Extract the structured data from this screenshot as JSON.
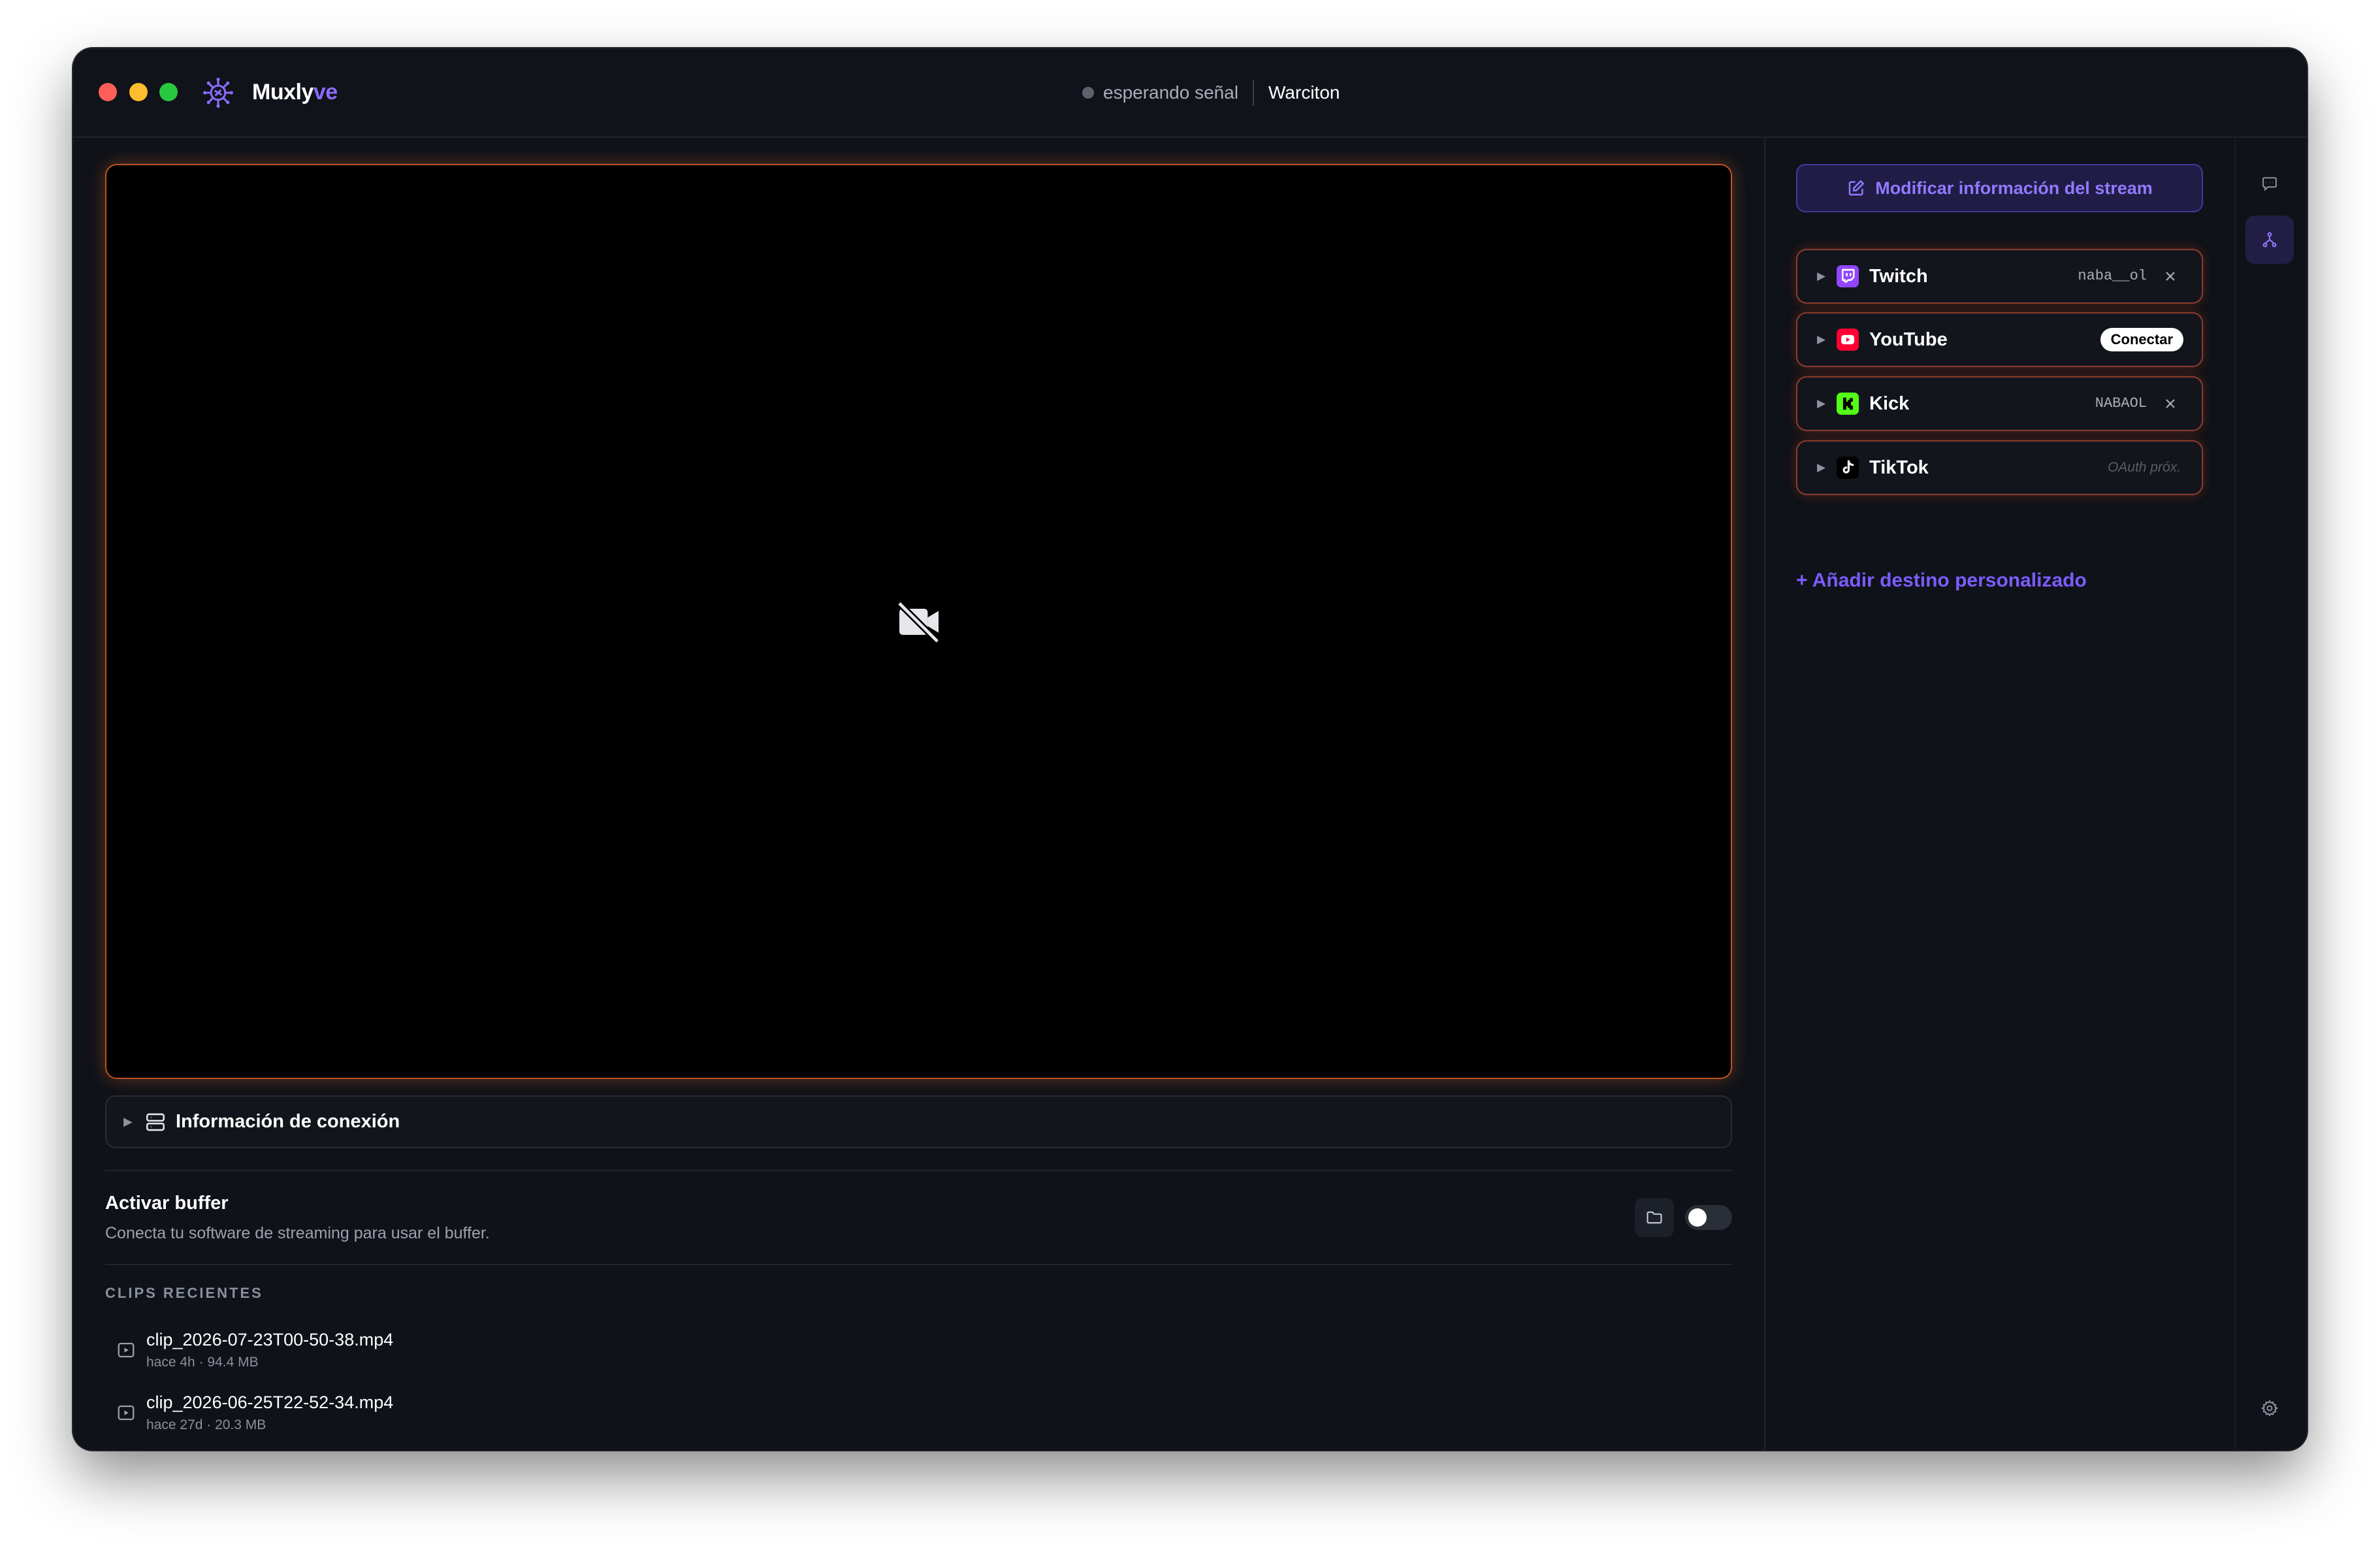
{
  "app": {
    "name_main": "Muxly",
    "name_accent": "ve",
    "logo_icon": "virus-logo-icon"
  },
  "status": {
    "text": "esperando señal",
    "channel": "Warciton",
    "state_color": "#5d626c"
  },
  "video": {
    "placeholder_icon": "camera-off-icon"
  },
  "connection": {
    "label": "Información de conexión",
    "icon": "server-icon"
  },
  "buffer": {
    "title": "Activar buffer",
    "subtitle": "Conecta tu software de streaming para usar el buffer.",
    "enabled": false,
    "folder_icon": "folder-icon"
  },
  "clips": {
    "heading": "CLIPS RECIENTES",
    "items": [
      {
        "name": "clip_2026-07-23T00-50-38.mp4",
        "meta": "hace 4h · 94.4 MB"
      },
      {
        "name": "clip_2026-06-25T22-52-34.mp4",
        "meta": "hace 27d · 20.3 MB"
      }
    ]
  },
  "sidebar": {
    "modify_label": "Modificar información del stream",
    "destinations": [
      {
        "name": "Twitch",
        "account": "naba__ol",
        "icon": "twitch-icon",
        "color": "#9146ff"
      },
      {
        "name": "YouTube",
        "action": "Conectar",
        "icon": "youtube-icon",
        "color": "#ff0033"
      },
      {
        "name": "Kick",
        "account": "NABAOL",
        "icon": "kick-icon",
        "color": "#53fc18"
      },
      {
        "name": "TikTok",
        "note": "OAuth próx.",
        "icon": "tiktok-icon",
        "color": "#000000"
      }
    ],
    "add_label": "+ Añadir destino personalizado"
  },
  "rail": {
    "icons": [
      "chat-icon",
      "sources-icon",
      "gear-icon"
    ],
    "active": "sources-icon"
  },
  "colors": {
    "accent": "#7c5cff",
    "window_bg": "#0f1218",
    "video_glow": "#b9541f",
    "card_glow": "#eb5f46"
  }
}
